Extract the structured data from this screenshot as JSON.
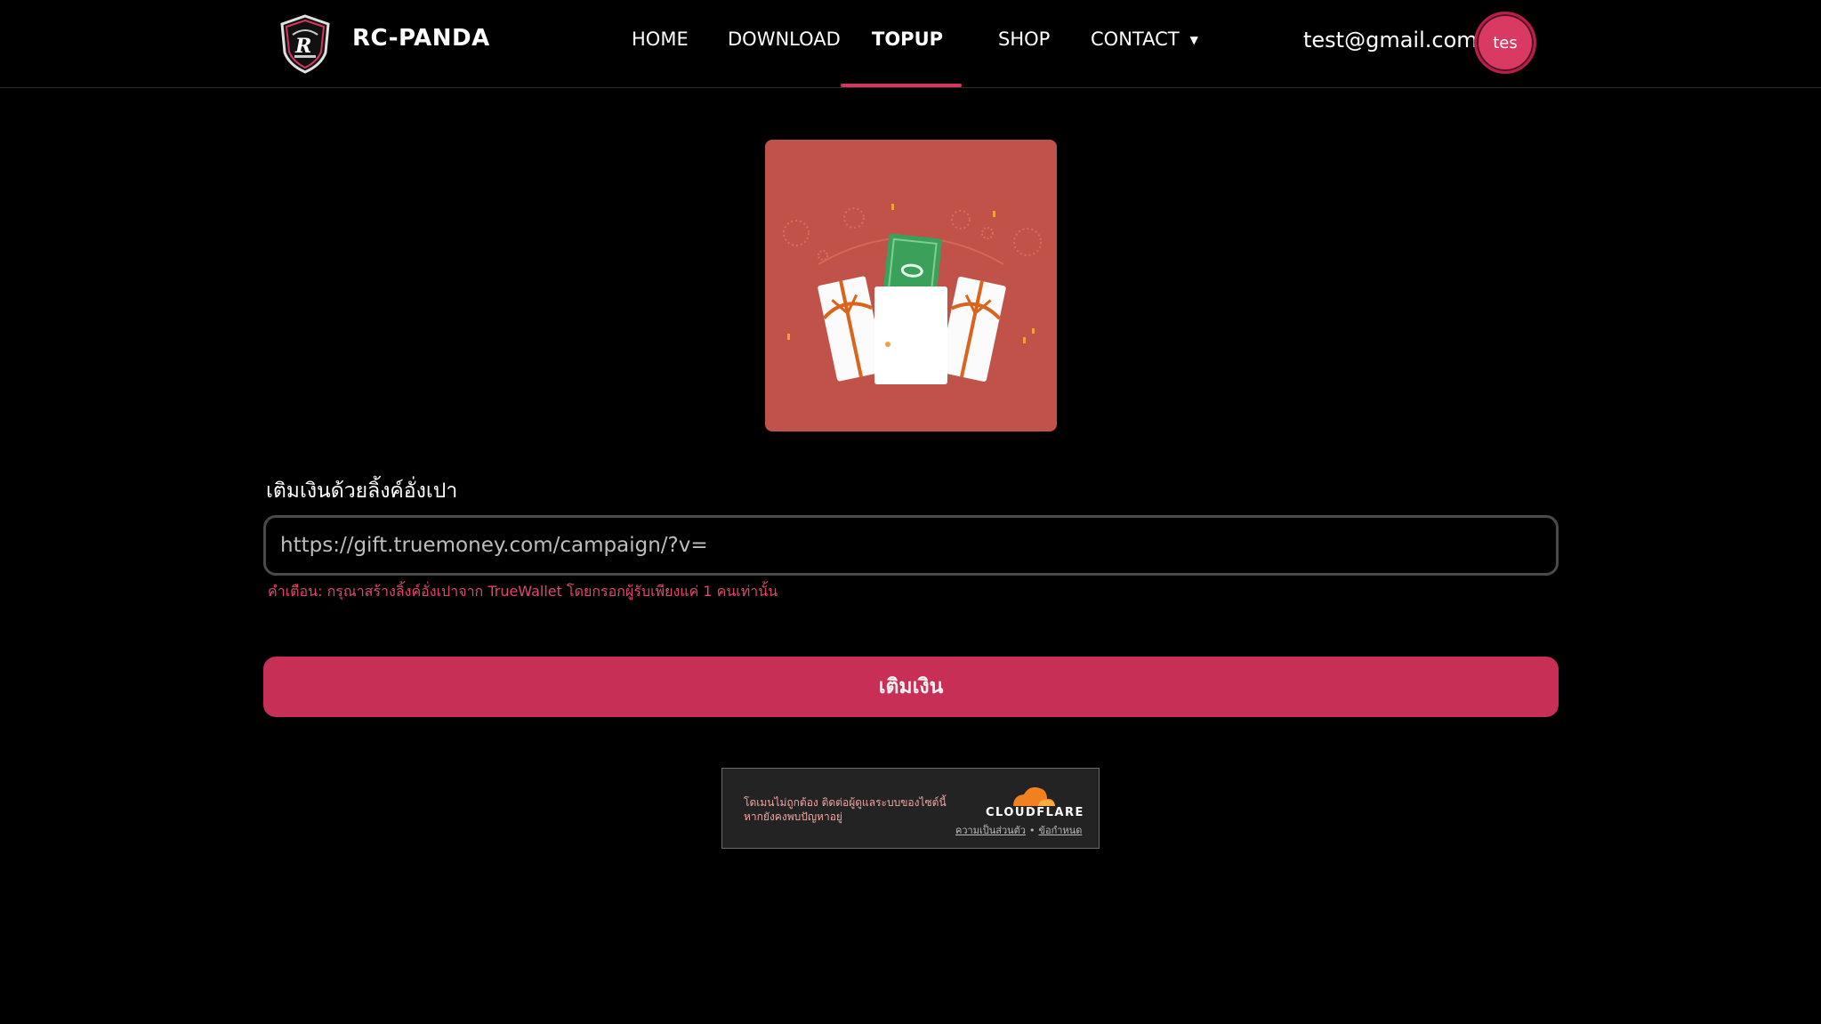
{
  "brand": {
    "name": "RC-PANDA",
    "logo_icon": "shield-r-logo-icon"
  },
  "nav": {
    "items": [
      {
        "label": "HOME"
      },
      {
        "label": "DOWNLOAD"
      },
      {
        "label": "TOPUP",
        "active": true
      },
      {
        "label": "SHOP"
      },
      {
        "label": "CONTACT"
      }
    ]
  },
  "user": {
    "email": "test@gmail.com",
    "avatar_text": "tes"
  },
  "hero": {
    "image_icon": "gift-envelope-icon"
  },
  "topup_form": {
    "label": "เติมเงินด้วยลิ้งค์อั่งเปา",
    "url_placeholder": "https://gift.truemoney.com/campaign/?v=",
    "warning": "คำเตือน: กรุณาสร้างลิ้งค์อั่งเปาจาก TrueWallet โดยกรอกผู้รับเพียงแค่ 1 คนเท่านั้น",
    "submit_label": "เติมเงิน"
  },
  "captcha": {
    "error_text": "โดเมนไม่ถูกต้อง ติดต่อผู้ดูแลระบบของไซต์นี้ หากยังคงพบปัญหาอยู่",
    "provider": "CLOUDFLARE",
    "privacy_label": "ความเป็นส่วนตัว",
    "separator": "•",
    "terms_label": "ข้อกำหนด"
  },
  "colors": {
    "accent": "#c72f57",
    "hero_background": "#c0524a",
    "warning_text": "#e0476d",
    "background": "#000000"
  }
}
